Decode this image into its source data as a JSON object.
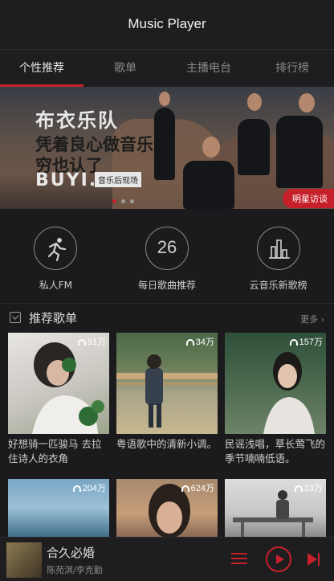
{
  "header": {
    "title": "Music Player"
  },
  "tabs": [
    {
      "label": "个性推荐",
      "active": true
    },
    {
      "label": "歌单",
      "active": false
    },
    {
      "label": "主播电台",
      "active": false
    },
    {
      "label": "排行榜",
      "active": false
    }
  ],
  "banner": {
    "line1": "布衣乐队",
    "line2": "凭着良心做音乐",
    "line3": "穷也认了",
    "line4": "BUYI.",
    "sub": "音乐后现场",
    "tag": "明星访谈"
  },
  "quick": [
    {
      "label": "私人FM",
      "icon": "runner-icon"
    },
    {
      "label": "每日歌曲推荐",
      "icon": "calendar-day-icon",
      "number": "26"
    },
    {
      "label": "云音乐新歌榜",
      "icon": "bar-chart-icon"
    }
  ],
  "section": {
    "title": "推荐歌单",
    "more": "更多"
  },
  "playlists": [
    {
      "plays": "51万",
      "title": "好想骑一匹骏马 去拉住诗人的衣角"
    },
    {
      "plays": "34万",
      "title": "粤语歌中的清新小调。"
    },
    {
      "plays": "157万",
      "title": "民谣浅唱，草长莺飞的季节喃喃低语。"
    },
    {
      "plays": "204万",
      "title": ""
    },
    {
      "plays": "624万",
      "title": ""
    },
    {
      "plays": "33万",
      "title": ""
    }
  ],
  "player": {
    "song": "合久必婚",
    "artist": "陈苑淇/李克勤"
  },
  "colors": {
    "accent": "#c6202a",
    "background": "#1b1b1d"
  }
}
